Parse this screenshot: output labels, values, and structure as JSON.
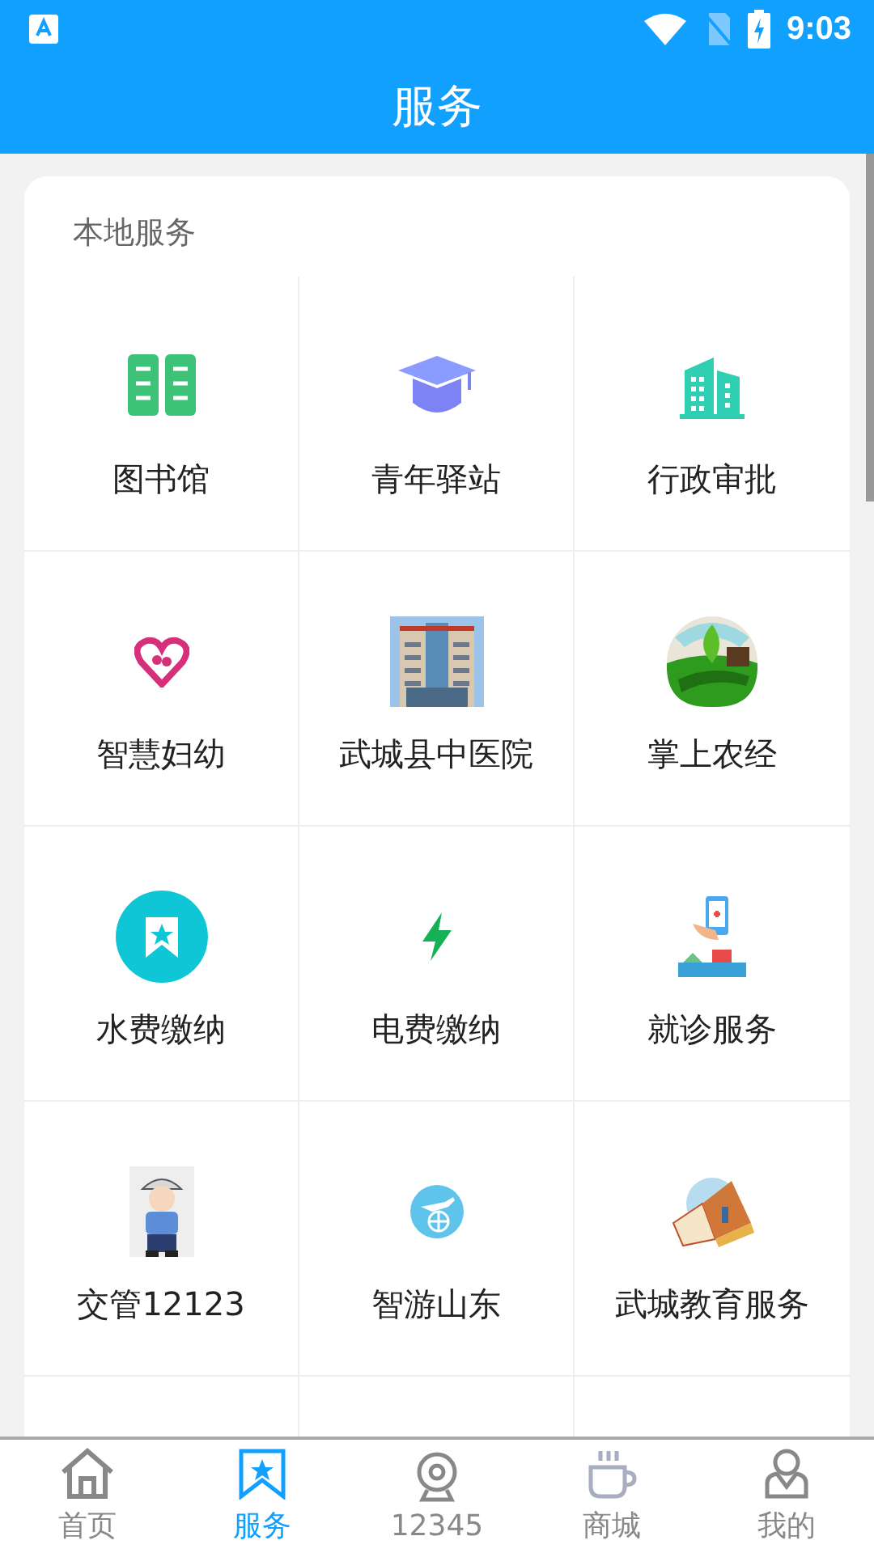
{
  "status_bar": {
    "time": "9:03"
  },
  "header": {
    "title": "服务"
  },
  "section": {
    "title": "本地服务",
    "tiles": [
      {
        "label": "图书馆"
      },
      {
        "label": "青年驿站"
      },
      {
        "label": "行政审批"
      },
      {
        "label": "智慧妇幼"
      },
      {
        "label": "武城县中医院"
      },
      {
        "label": "掌上农经"
      },
      {
        "label": "水费缴纳"
      },
      {
        "label": "电费缴纳"
      },
      {
        "label": "就诊服务"
      },
      {
        "label": "交管12123"
      },
      {
        "label": "智游山东"
      },
      {
        "label": "武城教育服务"
      }
    ]
  },
  "tab_bar": [
    {
      "label": "首页",
      "selected": false
    },
    {
      "label": "服务",
      "selected": true
    },
    {
      "label": "12345",
      "selected": false
    },
    {
      "label": "商城",
      "selected": false
    },
    {
      "label": "我的",
      "selected": false
    }
  ]
}
